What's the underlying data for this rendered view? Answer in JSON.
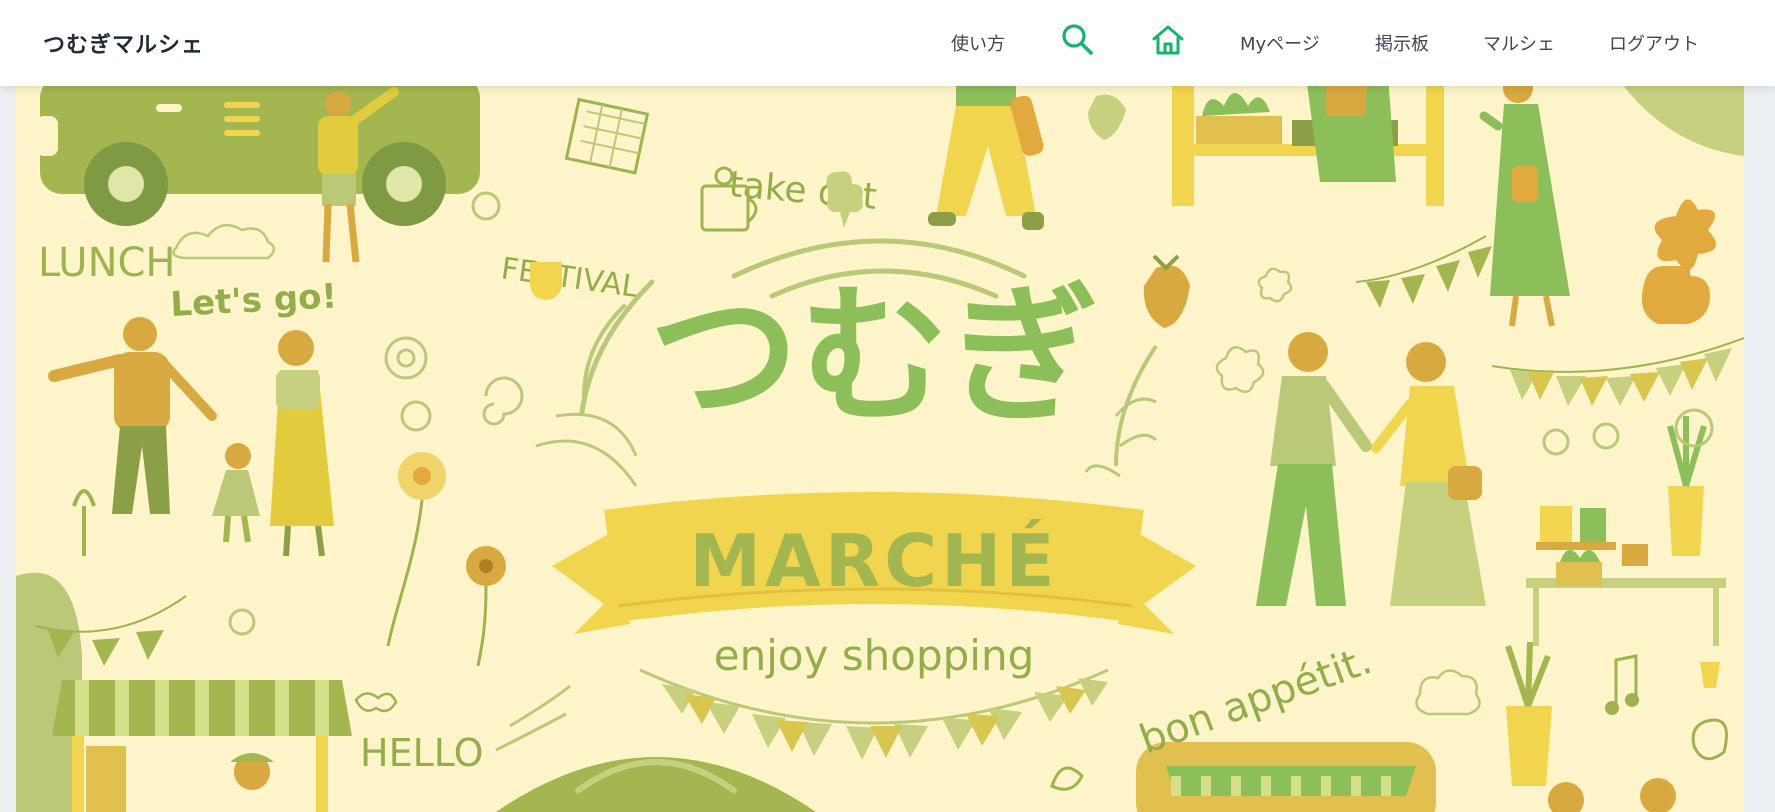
{
  "header": {
    "site_title": "つむぎマルシェ",
    "nav": {
      "howto": "使い方",
      "search_icon": "search-icon",
      "home_icon": "home-icon",
      "mypage": "Myページ",
      "board": "掲示板",
      "marche": "マルシェ",
      "logout": "ログアウト"
    },
    "accent_color": "#16b36c"
  },
  "hero": {
    "logo_text": "つむぎ",
    "banner_text": "MARCHÉ",
    "tagline": "enjoy shopping",
    "doodles": {
      "take_out": "take out",
      "festival": "FESTIVAL",
      "lunch": "LUNCH",
      "lets_go": "Let's go!",
      "hello": "HELLO",
      "bon_appetit": "bon appétit."
    },
    "colors": {
      "background": "#fdf5c9",
      "green": "#8cbf5a",
      "olive": "#a3b64f",
      "yellow": "#f2d54e",
      "mustard": "#d8a940"
    }
  }
}
